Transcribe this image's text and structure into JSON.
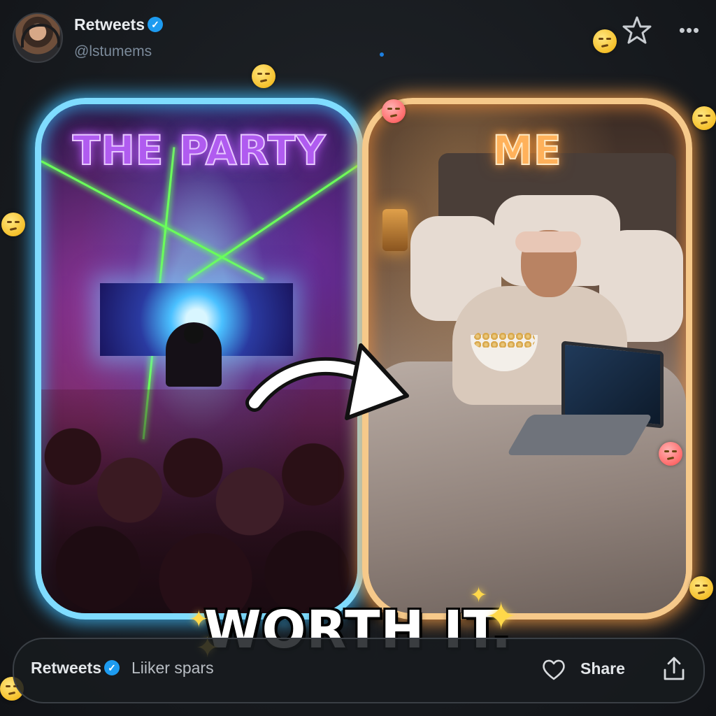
{
  "header": {
    "name": "Retweets",
    "handle": "@lstumems"
  },
  "panels": {
    "left_title": "THE PARTY",
    "right_title": "ME"
  },
  "caption": "WORTH IT.",
  "footer": {
    "name": "Retweets",
    "text": "Liiker spars",
    "share_label": "Share"
  },
  "colors": {
    "left_glow": "#7fdcff",
    "right_glow": "#f6c98a",
    "verified": "#1d9bf0"
  },
  "icons": [
    "star-icon",
    "more-icon",
    "verified-icon",
    "heart-icon",
    "share-icon",
    "curved-arrow-icon"
  ]
}
